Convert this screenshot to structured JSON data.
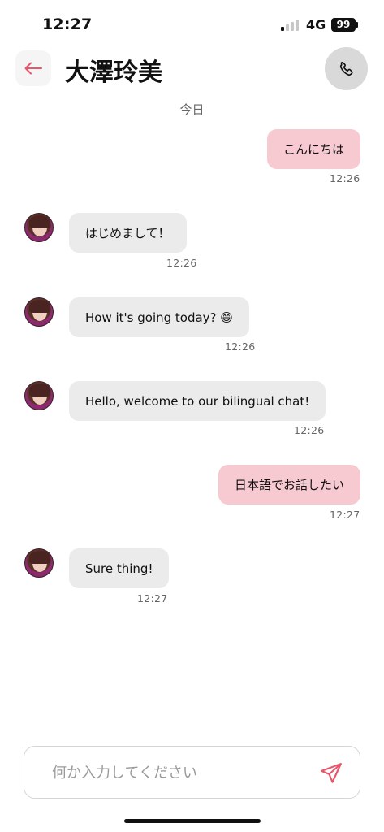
{
  "status_bar": {
    "time": "12:27",
    "network": "4G",
    "battery": "99"
  },
  "header": {
    "title": "大澤玲美"
  },
  "chat": {
    "day_label": "今日",
    "messages": [
      {
        "direction": "out",
        "text": "こんにちは",
        "time": "12:26"
      },
      {
        "direction": "in",
        "text": "はじめまして！",
        "time": "12:26"
      },
      {
        "direction": "in",
        "text": "How it's going today? 😄",
        "time": "12:26"
      },
      {
        "direction": "in",
        "text": "Hello, welcome to our bilingual chat!",
        "time": "12:26"
      },
      {
        "direction": "out",
        "text": "日本語でお話したい",
        "time": "12:27"
      },
      {
        "direction": "in",
        "text": "Sure thing!",
        "time": "12:27"
      }
    ]
  },
  "composer": {
    "placeholder": "何か入力してください"
  },
  "icons": {
    "back": "arrow-left-icon",
    "call": "phone-icon",
    "send": "send-icon",
    "avatar": "contact-avatar"
  },
  "colors": {
    "outgoing_bubble": "#f7c9d0",
    "incoming_bubble": "#ebebeb",
    "accent": "#e8566b"
  }
}
